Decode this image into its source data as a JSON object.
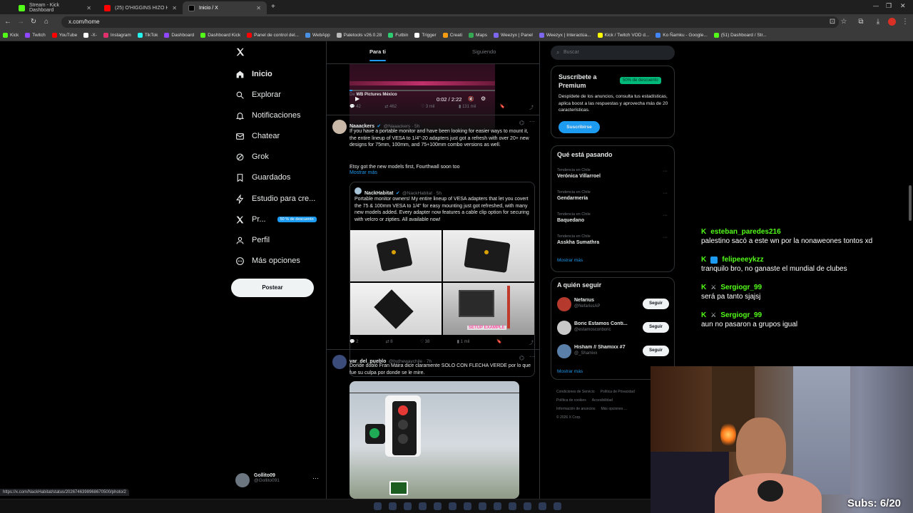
{
  "browser": {
    "tabs": [
      {
        "title": "Stream - Kick Dashboard",
        "color": "#53fc18"
      },
      {
        "title": "(25) O'HIGGINS HIZO HISTORIA",
        "color": "#ff0000"
      },
      {
        "title": "Inicio / X",
        "color": "#ffffff"
      }
    ],
    "url": "x.com/home",
    "bookmarks": [
      {
        "label": "Kick",
        "color": "#53fc18"
      },
      {
        "label": "Twitch",
        "color": "#9146ff"
      },
      {
        "label": "YouTube",
        "color": "#ff0000"
      },
      {
        "label": "-X-",
        "color": "#ffffff"
      },
      {
        "label": "Instagram",
        "color": "#e1306c"
      },
      {
        "label": "TikTok",
        "color": "#25f4ee"
      },
      {
        "label": "Dashboard",
        "color": "#9146ff"
      },
      {
        "label": "Dashboard Kick",
        "color": "#53fc18"
      },
      {
        "label": "Panel de control del...",
        "color": "#ff0000"
      },
      {
        "label": "WebApp",
        "color": "#4a90e2"
      },
      {
        "label": "Paletools v26.0.28",
        "color": "#bbbbbb"
      },
      {
        "label": "Futbin",
        "color": "#2ecc71"
      },
      {
        "label": "Trigger",
        "color": "#ffffff"
      },
      {
        "label": "Creati",
        "color": "#f39c12"
      },
      {
        "label": "Maps",
        "color": "#34a853"
      },
      {
        "label": "Weezyx | Panel",
        "color": "#7b68ee"
      },
      {
        "label": "Weezyx | Interactúa...",
        "color": "#7b68ee"
      },
      {
        "label": "Kick / Twitch VOD d...",
        "color": "#ffff00"
      },
      {
        "label": "Ko Ñamku - Google...",
        "color": "#4285f4"
      },
      {
        "label": "(51) Dashboard / Str...",
        "color": "#53fc18"
      }
    ],
    "status_url": "https://x.com/NackHabitat/status/2026746398968670500/photo/2"
  },
  "sidebar": {
    "items": [
      {
        "label": "Inicio",
        "icon": "home-icon"
      },
      {
        "label": "Explorar",
        "icon": "search-icon"
      },
      {
        "label": "Notificaciones",
        "icon": "bell-icon"
      },
      {
        "label": "Chatear",
        "icon": "mail-icon"
      },
      {
        "label": "Grok",
        "icon": "grok-icon"
      },
      {
        "label": "Guardados",
        "icon": "bookmark-icon"
      },
      {
        "label": "Estudio para cre...",
        "icon": "bolt-icon"
      },
      {
        "label": "Pr...",
        "icon": "x-premium-icon"
      },
      {
        "label": "Perfil",
        "icon": "person-icon"
      },
      {
        "label": "Más opciones",
        "icon": "more-circle-icon"
      }
    ],
    "premium_badge": "50 % de descuento",
    "post_label": "Postear",
    "account": {
      "name": "Gollito09",
      "handle": "@Gollito091"
    }
  },
  "feed": {
    "tabs": [
      "Para ti",
      "Siguiendo"
    ],
    "video": {
      "time": "0:02 / 2:22",
      "source_prefix": "De",
      "source": "WB Pictures México"
    },
    "tweet0_actions": {
      "replies": "42",
      "retweets": "462",
      "likes": "3 mil",
      "views": "131 mil"
    },
    "tweet1": {
      "name": "Naaackers",
      "handle": "@Naaackers · 5h",
      "text": "If you have a portable monitor and have been looking for easier ways to mount it, the entire lineup of VESA to 1/4\"-20 adapters just got a refresh with over 20+ new designs for 75mm, 100mm, and 75+100mm combo versions as well.",
      "text2": "Etsy got the new models first, Fourthwall soon too",
      "more": "Mostrar más",
      "quote": {
        "name": "NackHabitat",
        "handle": "@NackHabitat · 5h",
        "text": "Portable monitor owners! My entire lineup of VESA adapters that let you covert the 75 & 100mm VESA to 1/4\" for easy mounting just got refreshed, with many new models added. Every adapter now features a cable clip option for securing with velcro or zipties. All available now!",
        "image_label": "SETUP EXAMPLE"
      },
      "actions": {
        "replies": "2",
        "retweets": "8",
        "likes": "38",
        "views": "1 mil"
      }
    },
    "tweet2": {
      "name": "var_del_pueblo",
      "handle": "@bythewaychile · 7h",
      "text": "Donde dobló Fran Maira dice claramente SOLO CON FLECHA VERDE por lo que fue su culpa por donde se le mire."
    }
  },
  "right": {
    "search_placeholder": "Buscar",
    "premium": {
      "title": "Suscríbete a Premium",
      "badge": "50% de descuento",
      "text": "Despídete de los anuncios, consulta tus estadísticas, aplica boost a las respuestas y aprovecha más de 20 características.",
      "button": "Suscribirse"
    },
    "trends": {
      "title": "Qué está pasando",
      "items": [
        {
          "context": "Tendencia en Chile",
          "name": "Verónica Villarroel"
        },
        {
          "context": "Tendencia en Chile",
          "name": "Gendarmería"
        },
        {
          "context": "Tendencia en Chile",
          "name": "Baquedano"
        },
        {
          "context": "Tendencia en Chile",
          "name": "Asskha Sumathra"
        }
      ],
      "more": "Mostrar más"
    },
    "follow": {
      "title": "A quién seguir",
      "items": [
        {
          "name": "Nefarius",
          "handle": "@NefariusAP",
          "button": "Seguir"
        },
        {
          "name": "Boric Estamos Conti...",
          "handle": "@estamosconboric",
          "button": "Seguir"
        },
        {
          "name": "Hisham // Shamixx #7",
          "handle": "@_Shamixx",
          "button": "Seguir"
        }
      ],
      "more": "Mostrar más"
    },
    "footer": [
      "Condiciones de Servicio",
      "Política de Privacidad",
      "Política de cookies",
      "Accesibilidad",
      "Información de anuncios",
      "Más opciones ...",
      "© 2026 X Corp."
    ]
  },
  "chat": {
    "messages": [
      {
        "user": "esteban_paredes216",
        "text": "palestino sacó a este wn por la nonaweones tontos xd",
        "badge": ""
      },
      {
        "user": "felipeeeykzz",
        "text": "tranquilo bro, no ganaste el mundial de clubes",
        "badge": "x-badge"
      },
      {
        "user": "Sergiogr_99",
        "text": "será pa tanto sjajsj",
        "badge": "sword-badge"
      },
      {
        "user": "Sergiogr_99",
        "text": "aun no pasaron a grupos igual",
        "badge": "sword-badge"
      }
    ]
  },
  "overlay": {
    "subs": "Subs: 6/20"
  }
}
